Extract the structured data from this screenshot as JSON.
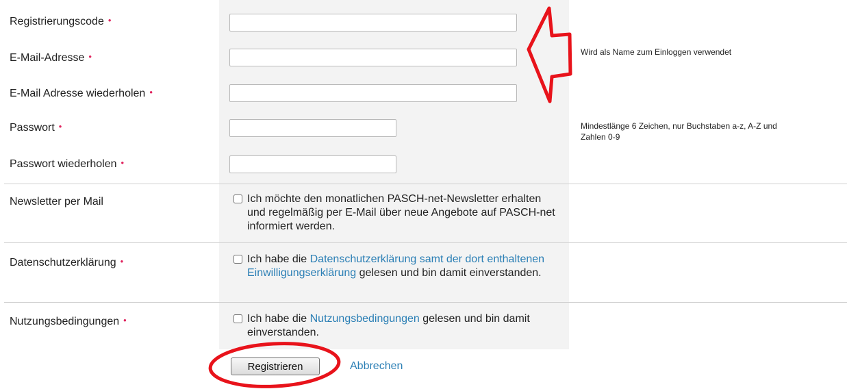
{
  "fields": [
    {
      "label": "Registrierungscode",
      "required_mark": "•",
      "value": ""
    },
    {
      "label": "E-Mail-Adresse",
      "required_mark": "•",
      "value": ""
    },
    {
      "label": "E-Mail Adresse wiederholen",
      "required_mark": "•",
      "value": ""
    },
    {
      "label": "Passwort",
      "required_mark": "•",
      "value": ""
    },
    {
      "label": "Passwort wiederholen",
      "required_mark": "•",
      "value": ""
    }
  ],
  "hints": {
    "email": "Wird als Name zum Einloggen verwendet",
    "password_line1": "Mindestlänge 6 Zeichen, nur Buchstaben a-z, A-Z und",
    "password_line2": "Zahlen 0-9"
  },
  "newsletter": {
    "label": "Newsletter per Mail",
    "checked": false,
    "text": "Ich möchte den monatlichen PASCH-net-Newsletter erhalten und regelmäßig per E-Mail über neue Angebote auf PASCH-net informiert werden."
  },
  "privacy": {
    "label": "Datenschutzerklärung",
    "required_mark": "•",
    "checked": false,
    "text_before": "Ich habe die ",
    "link_text": "Datenschutzerklärung samt der dort enthaltenen Einwilligungserklärung",
    "text_after": " gelesen und bin damit einverstanden."
  },
  "terms": {
    "label": "Nutzungsbedingungen",
    "required_mark": "•",
    "checked": false,
    "text_before": "Ich habe die ",
    "link_text": "Nutzungsbedingungen",
    "text_after": " gelesen und bin damit einverstanden."
  },
  "actions": {
    "submit_label": "Registrieren",
    "cancel_label": "Abbrechen"
  },
  "annotations": {
    "color": "#e8131b",
    "arrow_target": "e-mail fields",
    "circle_target": "register button"
  }
}
